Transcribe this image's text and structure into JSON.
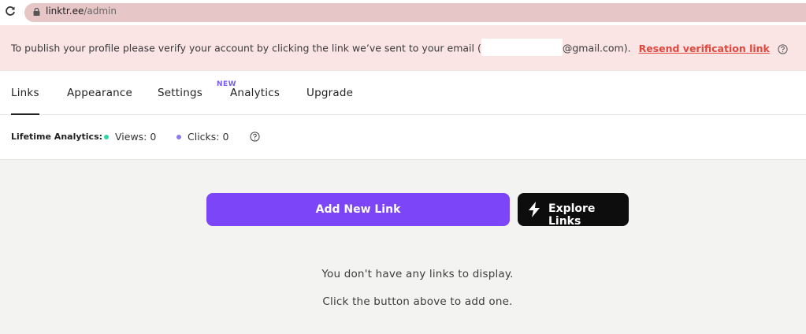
{
  "browser": {
    "url_host": "linktr.ee",
    "url_path": "/admin"
  },
  "banner": {
    "text_before": "To publish your profile please verify your account by clicking the link we’ve sent to your email (",
    "text_after": "@gmail.com).",
    "resend_link": "Resend verification link"
  },
  "tabs": [
    {
      "label": "Links",
      "active": true
    },
    {
      "label": "Appearance",
      "active": false
    },
    {
      "label": "Settings",
      "active": false
    },
    {
      "label": "Analytics",
      "active": false,
      "badge": "NEW"
    },
    {
      "label": "Upgrade",
      "active": false
    }
  ],
  "analytics": {
    "label": "Lifetime Analytics:",
    "views": "Views: 0",
    "clicks": "Clicks: 0",
    "views_color": "#2fd6a5",
    "clicks_color": "#8a7cf0"
  },
  "main": {
    "add_button": "Add New Link",
    "explore_button": "Explore Links",
    "empty_line1": "You don't have any links to display.",
    "empty_line2": "Click the button above to add one."
  },
  "colors": {
    "accent": "#7c45f7",
    "banner_bg": "#fbe4e4",
    "link_red": "#e0483e"
  }
}
